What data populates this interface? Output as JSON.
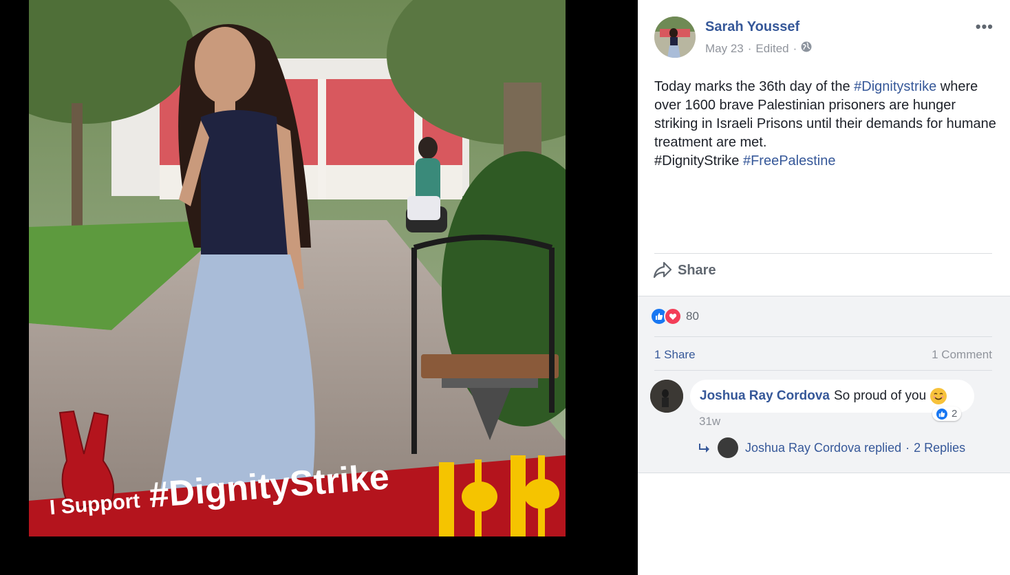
{
  "photo": {
    "banner_prefix": "I Support",
    "banner_hashtag": "#DignityStrike",
    "colors": {
      "banner_red": "#b4141d",
      "banner_yellow": "#f5c400"
    }
  },
  "post": {
    "author": "Sarah Youssef",
    "date": "May 23",
    "edited": "Edited",
    "privacy_icon": "globe-icon",
    "more_label": "•••",
    "text_before": "Today marks the 36th day of the ",
    "hashtag1": "#Dignitystrike",
    "text_middle": " where over 1600 brave Palestinian prisoners are hunger striking in Israeli Prisons until their demands for humane treatment are met.",
    "plain_tag": "#DignityStrike",
    "hashtag2": "#FreePalestine",
    "share_label": "Share"
  },
  "feedback": {
    "reaction_count": "80",
    "shares_label": "1 Share",
    "comments_label": "1 Comment"
  },
  "comment": {
    "author": "Joshua Ray Cordova",
    "text": "So proud of you",
    "like_count": "2",
    "time": "31w",
    "reply_summary": "Joshua Ray Cordova replied",
    "reply_sep": "·",
    "replies_label": "2 Replies"
  },
  "colors": {
    "link": "#365899",
    "muted": "#90949c",
    "like_blue": "#1877f2",
    "love_red": "#f33e58"
  }
}
